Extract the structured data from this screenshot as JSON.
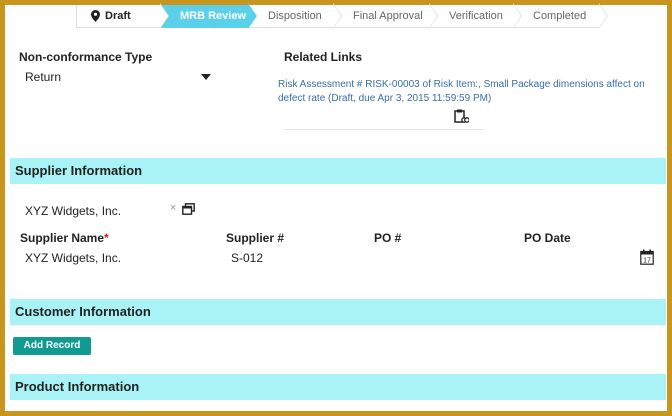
{
  "steps": [
    {
      "label": "Draft",
      "state": "current"
    },
    {
      "label": "MRB Review",
      "state": "active"
    },
    {
      "label": "Disposition",
      "state": ""
    },
    {
      "label": "Final Approval",
      "state": ""
    },
    {
      "label": "Verification",
      "state": ""
    },
    {
      "label": "Completed",
      "state": ""
    }
  ],
  "nonconformance": {
    "label": "Non-conformance Type",
    "value": "Return"
  },
  "related": {
    "label": "Related Links",
    "link_text": "Risk Assessment # RISK-00003 of Risk Item:, Small Package dimensions affect on defect rate (Draft, due Apr 3, 2015 11:59:59 PM)"
  },
  "supplier": {
    "title": "Supplier Information",
    "lookup_value": "XYZ Widgets, Inc.",
    "clear_glyph": "×",
    "columns": {
      "name": "Supplier Name",
      "required": "*",
      "number": "Supplier #",
      "po": "PO #",
      "po_date": "PO Date"
    },
    "row": {
      "name": "XYZ Widgets, Inc.",
      "number": "S-012",
      "po": "",
      "po_date": ""
    }
  },
  "customer": {
    "title": "Customer Information",
    "add_button": "Add Record"
  },
  "product": {
    "title": "Product Information"
  },
  "colors": {
    "accent": "#5bd0ea",
    "section_bg": "#a9f3f6",
    "button": "#119a92",
    "frame": "#c8961e",
    "link": "#3a6ea5"
  }
}
